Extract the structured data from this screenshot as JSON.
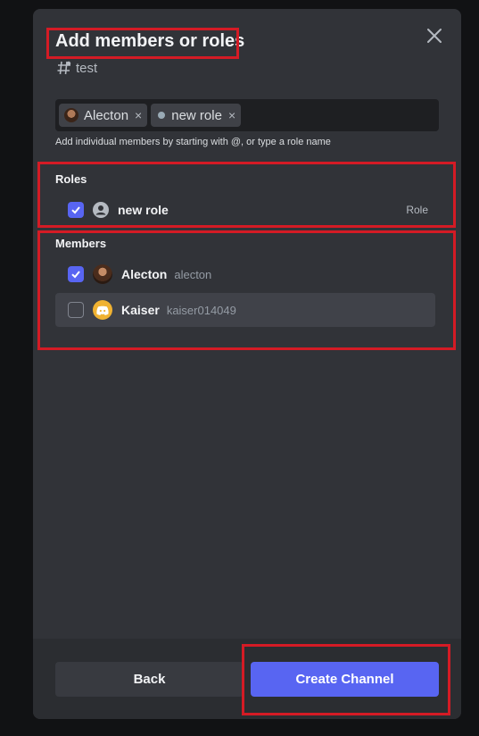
{
  "modal": {
    "title": "Add members or roles",
    "channel_name": "test"
  },
  "tag_input": {
    "chips": [
      {
        "label": "Alecton",
        "remove": "×"
      },
      {
        "label": "new role",
        "remove": "×"
      }
    ],
    "hint": "Add individual members by starting with @, or type a role name"
  },
  "roles": {
    "heading": "Roles",
    "items": [
      {
        "name": "new role",
        "type": "Role",
        "checked": true
      }
    ]
  },
  "members": {
    "heading": "Members",
    "items": [
      {
        "name": "Alecton",
        "handle": "alecton",
        "checked": true
      },
      {
        "name": "Kaiser",
        "handle": "kaiser014049",
        "checked": false
      }
    ]
  },
  "footer": {
    "back_label": "Back",
    "create_label": "Create Channel"
  },
  "colors": {
    "accent": "#5865f2",
    "highlight": "#d41b25"
  }
}
